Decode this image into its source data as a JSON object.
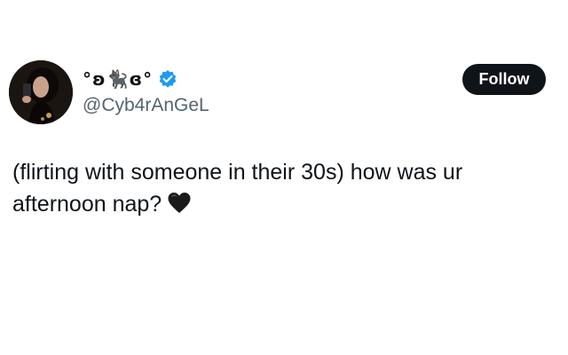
{
  "tweet": {
    "display_name": "°ʚ🐈‍⬛ɞ°",
    "handle": "@Cyb4rAnGeL",
    "follow_label": "Follow",
    "text": "(flirting with someone in their 30s) how was ur afternoon nap?",
    "emoji_icon": "black-heart-icon",
    "verified_icon": "verified-badge-icon"
  },
  "colors": {
    "text": "#0f1419",
    "secondary_text": "#536471",
    "verified_blue": "#1d9bf0",
    "follow_bg": "#0f1419",
    "background": "#ffffff"
  }
}
